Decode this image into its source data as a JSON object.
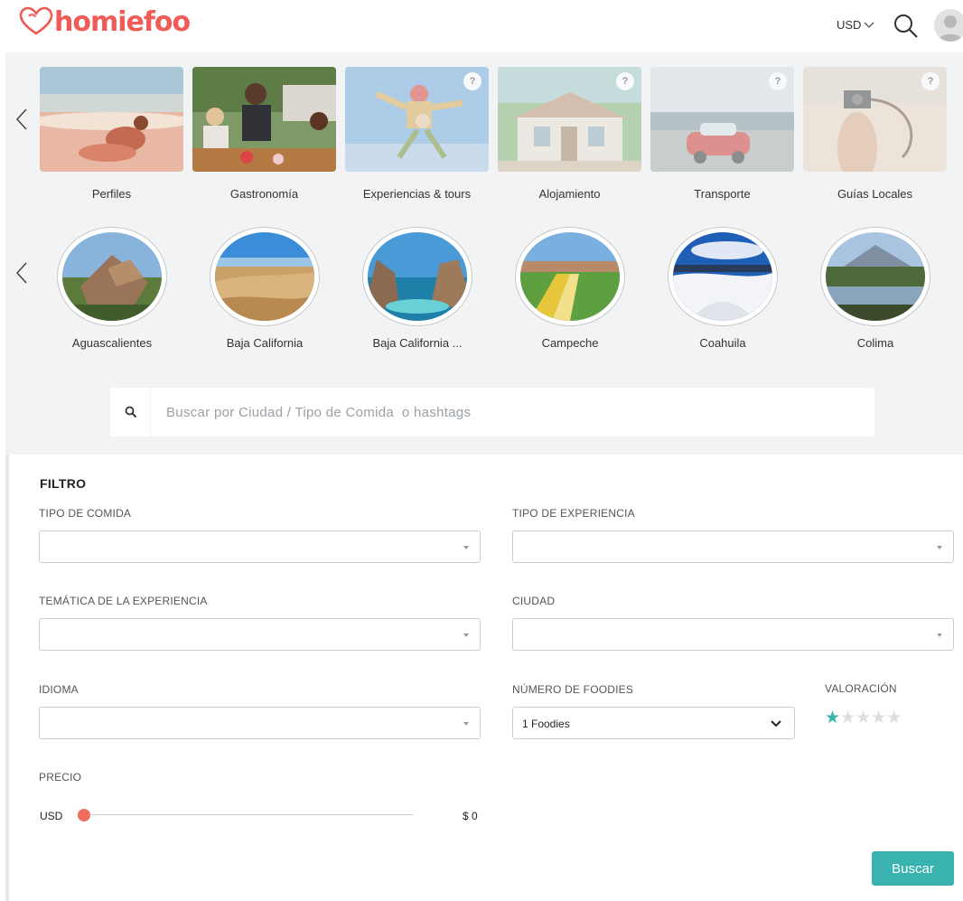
{
  "header": {
    "logo_text": "homiefoo",
    "currency": "USD"
  },
  "categories": [
    {
      "label": "Perfiles",
      "has_badge": false
    },
    {
      "label": "Gastronomía",
      "has_badge": false
    },
    {
      "label": "Experiencias & tours",
      "has_badge": true
    },
    {
      "label": "Alojamiento",
      "has_badge": true
    },
    {
      "label": "Transporte",
      "has_badge": true
    },
    {
      "label": "Guías Locales",
      "has_badge": true
    }
  ],
  "badge_text": "?",
  "states": [
    {
      "label": "Aguascalientes"
    },
    {
      "label": "Baja California"
    },
    {
      "label": "Baja California ..."
    },
    {
      "label": "Campeche"
    },
    {
      "label": "Coahuila"
    },
    {
      "label": "Colima"
    }
  ],
  "search": {
    "placeholder": "Buscar por Ciudad / Tipo de Comida  o hashtags",
    "value": ""
  },
  "filter": {
    "title": "FILTRO",
    "tipo_comida_label": "TIPO DE COMIDA",
    "tipo_experiencia_label": "TIPO DE EXPERIENCIA",
    "tematica_label": "TEMÁTICA DE LA EXPERIENCIA",
    "ciudad_label": "CIUDAD",
    "idioma_label": "IDIOMA",
    "foodies_label": "NÚMERO DE FOODIES",
    "foodies_value": "1 Foodies",
    "valoracion_label": "VALORACIÓN",
    "rating": 1,
    "rating_max": 5,
    "precio_label": "PRECIO",
    "price_currency": "USD",
    "price_value": "$ 0",
    "price_level": 0,
    "buscar_label": "Buscar"
  },
  "colors": {
    "brand": "#ef5b57",
    "accent": "#3ab3b0",
    "slider": "#ef6f5e",
    "star_on": "#3ab3b0",
    "star_off": "#dddddd"
  }
}
